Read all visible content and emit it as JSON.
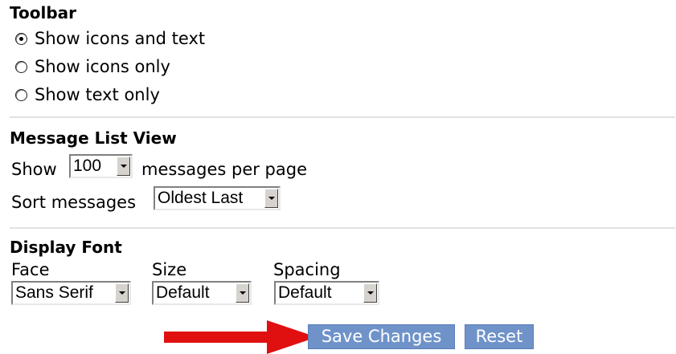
{
  "toolbar": {
    "title": "Toolbar",
    "options": [
      {
        "label": "Show icons and text",
        "checked": true
      },
      {
        "label": "Show icons only",
        "checked": false
      },
      {
        "label": "Show text only",
        "checked": false
      }
    ]
  },
  "message_list_view": {
    "title": "Message List View",
    "show_label": "Show",
    "per_page_value": "100",
    "per_page_suffix": "messages per page",
    "sort_label": "Sort messages",
    "sort_value": "Oldest Last"
  },
  "display_font": {
    "title": "Display Font",
    "face_label": "Face",
    "face_value": "Sans Serif",
    "size_label": "Size",
    "size_value": "Default",
    "spacing_label": "Spacing",
    "spacing_value": "Default"
  },
  "actions": {
    "save_label": "Save Changes",
    "reset_label": "Reset"
  },
  "colors": {
    "button": "#6f93c9",
    "annotation_arrow": "#e01010"
  },
  "icons": {
    "annotation": "red-arrow-right-icon",
    "dropdown": "chevron-down-icon"
  }
}
